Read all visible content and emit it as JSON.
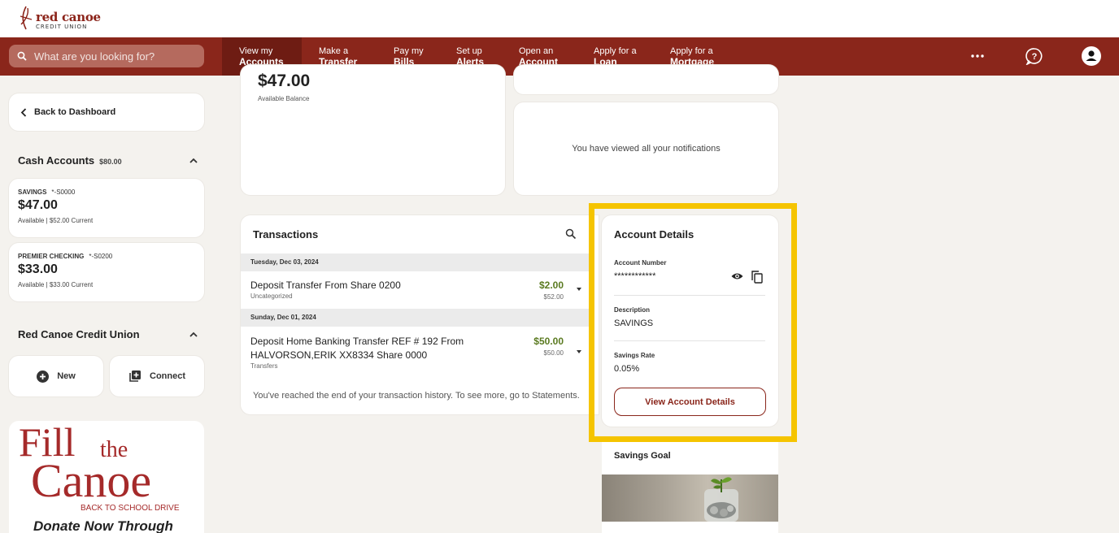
{
  "brand": {
    "name": "red canoe",
    "sub": "CREDIT UNION",
    "color": "#8a261b"
  },
  "search": {
    "placeholder": "What are you looking for?"
  },
  "nav": [
    {
      "line1": "View my",
      "line2": "Accounts",
      "active": true
    },
    {
      "line1": "Make a",
      "line2": "Transfer"
    },
    {
      "line1": "Pay my",
      "line2": "Bills"
    },
    {
      "line1": "Set up",
      "line2": "Alerts"
    },
    {
      "line1": "Open an",
      "line2": "Account"
    },
    {
      "line1": "Apply for a",
      "line2": "Loan"
    },
    {
      "line1": "Apply for a",
      "line2": "Mortgage"
    }
  ],
  "nav_icons": [
    "more-icon",
    "help-chat-icon",
    "profile-icon"
  ],
  "sidebar": {
    "back_label": "Back to Dashboard",
    "cash_title": "Cash Accounts",
    "cash_total": "$80.00",
    "accounts": [
      {
        "name": "SAVINGS",
        "number": "*-S0000",
        "balance": "$47.00",
        "sub": "Available  |  $52.00 Current"
      },
      {
        "name": "PREMIER CHECKING",
        "number": "*-S0200",
        "balance": "$33.00",
        "sub": "Available  |  $33.00 Current"
      }
    ],
    "cu_title": "Red Canoe Credit Union",
    "new_label": "New",
    "connect_label": "Connect"
  },
  "promo": {
    "fill": "Fill",
    "the": "the",
    "canoe": "Canoe",
    "drive": "BACK TO SCHOOL DRIVE",
    "donate": "Donate Now Through"
  },
  "balance": {
    "amount": "$47.00",
    "label": "Available Balance"
  },
  "notifications": {
    "text": "You have viewed all your notifications"
  },
  "transactions": {
    "title": "Transactions",
    "groups": [
      {
        "date": "Tuesday, Dec 03, 2024",
        "items": [
          {
            "desc": "Deposit Transfer From Share 0200",
            "category": "Uncategorized",
            "amount": "$2.00",
            "balance": "$52.00"
          }
        ]
      },
      {
        "date": "Sunday, Dec 01, 2024",
        "items": [
          {
            "desc": "Deposit Home Banking Transfer REF # 192 From HALVORSON,ERIK XX8334 Share 0000",
            "category": "Transfers",
            "amount": "$50.00",
            "balance": "$50.00"
          }
        ]
      }
    ],
    "end_text": "You've reached the end of your transaction history. To see more, go to Statements."
  },
  "account_details": {
    "title": "Account Details",
    "number_label": "Account Number",
    "number_value": "************",
    "description_label": "Description",
    "description_value": "SAVINGS",
    "rate_label": "Savings Rate",
    "rate_value": "0.05%",
    "button_label": "View Account Details",
    "highlight_color": "#f5c400"
  },
  "savings_goal": {
    "title": "Savings Goal"
  }
}
